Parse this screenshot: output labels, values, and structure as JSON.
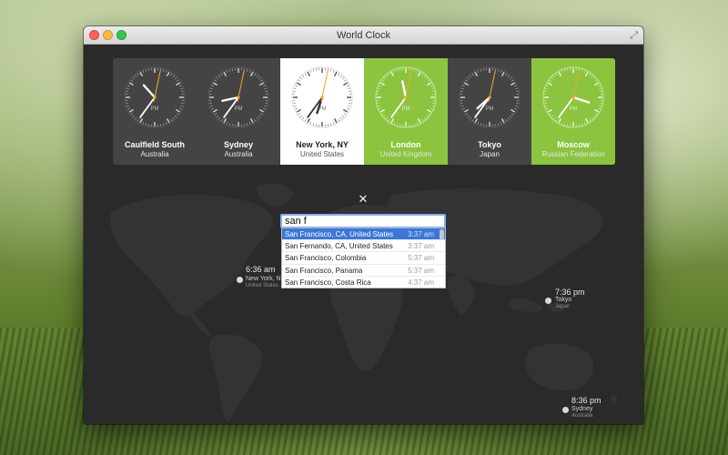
{
  "window": {
    "title": "World Clock"
  },
  "clocks": [
    {
      "city": "Caulfield South",
      "country": "Australia",
      "style": "dark",
      "hour": 10,
      "minute": 36,
      "second": 2
    },
    {
      "city": "Sydney",
      "country": "Australia",
      "style": "dark",
      "hour": 8,
      "minute": 36,
      "second": 2
    },
    {
      "city": "New York, NY",
      "country": "United States",
      "style": "white",
      "hour": 6,
      "minute": 36,
      "second": 2
    },
    {
      "city": "London",
      "country": "United Kingdom",
      "style": "green",
      "hour": 11,
      "minute": 36,
      "second": 2
    },
    {
      "city": "Tokyo",
      "country": "Japan",
      "style": "dark",
      "hour": 7,
      "minute": 36,
      "second": 2
    },
    {
      "city": "Moscow",
      "country": "Russian Federation",
      "style": "green",
      "hour": 3,
      "minute": 36,
      "second": 2
    }
  ],
  "clock_face_label": "PM",
  "colors": {
    "accent_green": "#8cc43f",
    "selection_blue": "#3b77d6",
    "second_hand": "#f5a623"
  },
  "search": {
    "value": "san f",
    "results": [
      {
        "label": "San Francisco, CA, United States",
        "time": "3:37 am",
        "selected": true
      },
      {
        "label": "San Fernando, CA, United States",
        "time": "3:37 am",
        "selected": false
      },
      {
        "label": "San Francisco, Colombia",
        "time": "5:37 am",
        "selected": false
      },
      {
        "label": "San Francisco, Panama",
        "time": "5:37 am",
        "selected": false
      },
      {
        "label": "San Francisco, Costa Rica",
        "time": "4:37 am",
        "selected": false
      }
    ]
  },
  "map_markers": {
    "newyork": {
      "time": "6:36 am",
      "city": "New York, NY",
      "country": "United States"
    },
    "tokyo": {
      "time": "7:36 pm",
      "city": "Tokyo",
      "country": "Japan"
    },
    "sydney": {
      "time": "8:36 pm",
      "city": "Sydney",
      "country": "Australia"
    }
  },
  "close_icon": "close-icon"
}
